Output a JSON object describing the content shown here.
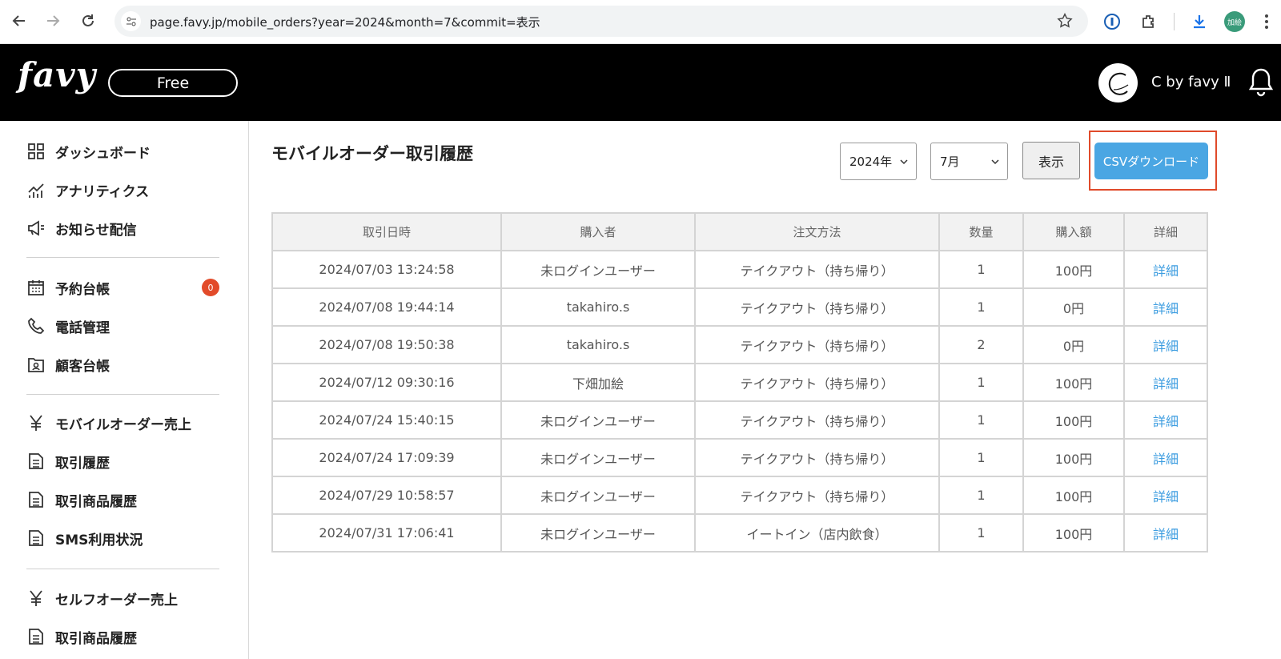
{
  "browser": {
    "url": "page.favy.jp/mobile_orders?year=2024&month=7&commit=表示",
    "profile_initials": "加絵"
  },
  "header": {
    "logo": "favy",
    "plan": "Free",
    "shop_name": "C by favy Ⅱ"
  },
  "sidebar": {
    "items": [
      {
        "label": "ダッシュボード",
        "icon": "grid-icon"
      },
      {
        "label": "アナリティクス",
        "icon": "chart-icon"
      },
      {
        "label": "お知らせ配信",
        "icon": "megaphone-icon"
      },
      {
        "label": "予約台帳",
        "icon": "calendar-icon",
        "badge": "0"
      },
      {
        "label": "電話管理",
        "icon": "phone-icon"
      },
      {
        "label": "顧客台帳",
        "icon": "customer-card-icon"
      },
      {
        "label": "モバイルオーダー売上",
        "icon": "yen-icon"
      },
      {
        "label": "取引履歴",
        "icon": "document-icon"
      },
      {
        "label": "取引商品履歴",
        "icon": "document-icon"
      },
      {
        "label": "SMS利用状況",
        "icon": "document-icon"
      },
      {
        "label": "セルフオーダー売上",
        "icon": "yen-icon"
      },
      {
        "label": "取引商品履歴",
        "icon": "document-icon"
      }
    ]
  },
  "main": {
    "title": "モバイルオーダー取引履歴",
    "year_select": "2024年",
    "month_select": "7月",
    "show_button": "表示",
    "csv_button": "CSVダウンロード",
    "table": {
      "headers": [
        "取引日時",
        "購入者",
        "注文方法",
        "数量",
        "購入額",
        "詳細"
      ],
      "rows": [
        [
          "2024/07/03 13:24:58",
          "未ログインユーザー",
          "テイクアウト（持ち帰り）",
          "1",
          "100円",
          "詳細"
        ],
        [
          "2024/07/08 19:44:14",
          "takahiro.s",
          "テイクアウト（持ち帰り）",
          "1",
          "0円",
          "詳細"
        ],
        [
          "2024/07/08 19:50:38",
          "takahiro.s",
          "テイクアウト（持ち帰り）",
          "2",
          "0円",
          "詳細"
        ],
        [
          "2024/07/12 09:30:16",
          "下畑加絵",
          "テイクアウト（持ち帰り）",
          "1",
          "100円",
          "詳細"
        ],
        [
          "2024/07/24 15:40:15",
          "未ログインユーザー",
          "テイクアウト（持ち帰り）",
          "1",
          "100円",
          "詳細"
        ],
        [
          "2024/07/24 17:09:39",
          "未ログインユーザー",
          "テイクアウト（持ち帰り）",
          "1",
          "100円",
          "詳細"
        ],
        [
          "2024/07/29 10:58:57",
          "未ログインユーザー",
          "テイクアウト（持ち帰り）",
          "1",
          "100円",
          "詳細"
        ],
        [
          "2024/07/31 17:06:41",
          "未ログインユーザー",
          "イートイン（店内飲食）",
          "1",
          "100円",
          "詳細"
        ]
      ]
    }
  },
  "colors": {
    "accent": "#4aa6e3",
    "highlight": "#e04a2a",
    "badge": "#e24b2a",
    "header_bg": "#000000"
  }
}
